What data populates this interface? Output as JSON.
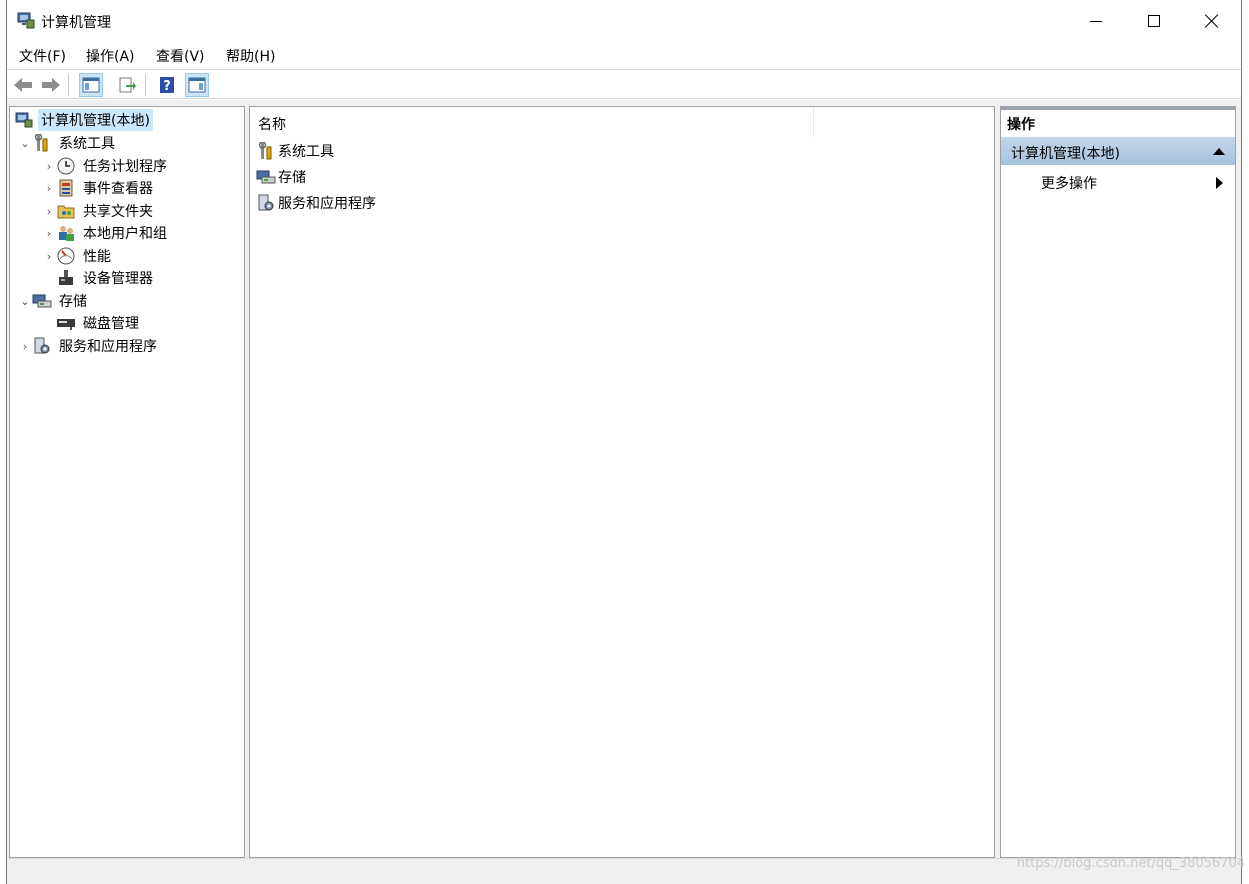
{
  "window": {
    "title": "计算机管理"
  },
  "menu": {
    "items": [
      "文件(F)",
      "操作(A)",
      "查看(V)",
      "帮助(H)"
    ]
  },
  "toolbar": {
    "buttons": [
      "back-arrow-icon",
      "forward-arrow-icon",
      "show-hide-console-tree-icon",
      "export-list-icon",
      "help-icon",
      "show-hide-action-pane-icon"
    ]
  },
  "tree": {
    "root": "计算机管理(本地)",
    "items": [
      {
        "label": "系统工具",
        "icon": "system-tools-icon",
        "expanded": true
      },
      {
        "label": "任务计划程序",
        "icon": "task-scheduler-icon"
      },
      {
        "label": "事件查看器",
        "icon": "event-viewer-icon"
      },
      {
        "label": "共享文件夹",
        "icon": "shared-folders-icon"
      },
      {
        "label": "本地用户和组",
        "icon": "local-users-groups-icon"
      },
      {
        "label": "性能",
        "icon": "performance-icon"
      },
      {
        "label": "设备管理器",
        "icon": "device-manager-icon"
      },
      {
        "label": "存储",
        "icon": "storage-icon",
        "expanded": true
      },
      {
        "label": "磁盘管理",
        "icon": "disk-management-icon"
      },
      {
        "label": "服务和应用程序",
        "icon": "services-applications-icon"
      }
    ]
  },
  "list": {
    "column_name": "名称",
    "rows": [
      "系统工具",
      "存储",
      "服务和应用程序"
    ]
  },
  "actions": {
    "header": "操作",
    "section": "计算机管理(本地)",
    "more": "更多操作"
  },
  "watermark": "https://blog.csdn.net/qq_38056704",
  "colors": {
    "selection": "#cce8ff",
    "action_section": "#a7c2df"
  }
}
